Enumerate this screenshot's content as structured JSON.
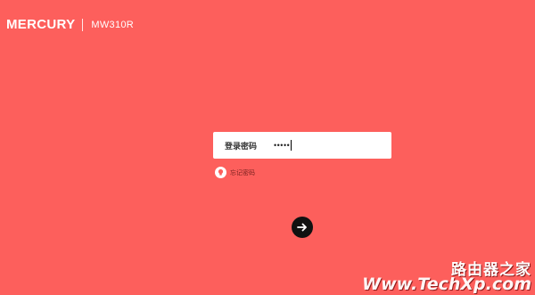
{
  "header": {
    "brand": "MERCURY",
    "model": "MW310R"
  },
  "login": {
    "password_label": "登录密码",
    "password_value": "•••••",
    "forgot_label": "忘记密码"
  },
  "watermark": {
    "cn": "路由器之家",
    "url": "Www.TechXp.com"
  },
  "colors": {
    "background": "#fd5f5c",
    "field_bg": "#ffffff",
    "button_bg": "#111111"
  },
  "icons": {
    "forgot": "lightbulb-icon",
    "submit": "arrow-right-icon"
  }
}
